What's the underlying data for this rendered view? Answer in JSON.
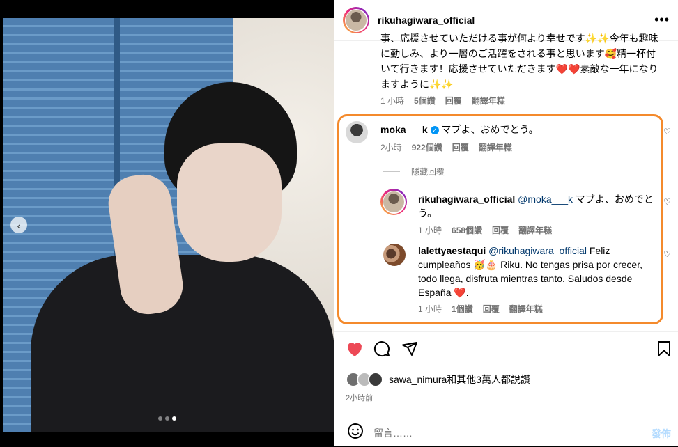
{
  "post": {
    "author": "rikuhagiwara_official",
    "more_icon": "more-horizontal-icon",
    "carousel": {
      "prev_icon": "chevron-left-icon",
      "count": 3,
      "active_index": 2
    }
  },
  "caption": {
    "text": "事、応援させていただける事が何より幸せです✨✨今年も趣味に勤しみ、より一層のご活躍をされる事と思います🥰精一杯付いて行きます！応援させていただきます❤️❤️素敵な一年になりますように✨✨",
    "time": "1 小時",
    "likes": "5個讚",
    "reply": "回覆",
    "translate": "翻譯年糕"
  },
  "comments": [
    {
      "user": "moka___k",
      "verified_icon": "verified-badge-icon",
      "text": "マブよ、おめでとう。",
      "time": "2小時",
      "likes": "922個讚",
      "reply": "回覆",
      "translate": "翻譯年糕"
    }
  ],
  "hide_replies": "隱藏回覆",
  "replies": [
    {
      "user": "rikuhagiwara_official",
      "mention": "@moka___k",
      "text": "マブよ、おめでとう。",
      "time": "1 小時",
      "likes": "658個讚",
      "reply": "回覆",
      "translate": "翻譯年糕"
    },
    {
      "user": "lalettyaestaqui",
      "mention": "@rikuhagiwara_official",
      "text": "Feliz cumpleaños 🥳🎂 Riku. No tengas prisa por crecer, todo llega, disfruta mientras tanto. Saludos desde España ❤️.",
      "time": "1 小時",
      "likes": "1個讚",
      "reply": "回覆",
      "translate": "翻譯年糕"
    }
  ],
  "actions": {
    "like_icon": "heart-filled-icon",
    "comment_icon": "comment-icon",
    "share_icon": "share-icon",
    "save_icon": "bookmark-icon"
  },
  "likes_line": "sawa_nimura和其他3萬人都說讚",
  "posted_time": "2小時前",
  "compose": {
    "emoji_icon": "emoji-icon",
    "placeholder": "留言……",
    "post_label": "發佈"
  },
  "colors": {
    "highlight": "#f48a2c",
    "like": "#ed4956",
    "mention": "#00376b"
  }
}
